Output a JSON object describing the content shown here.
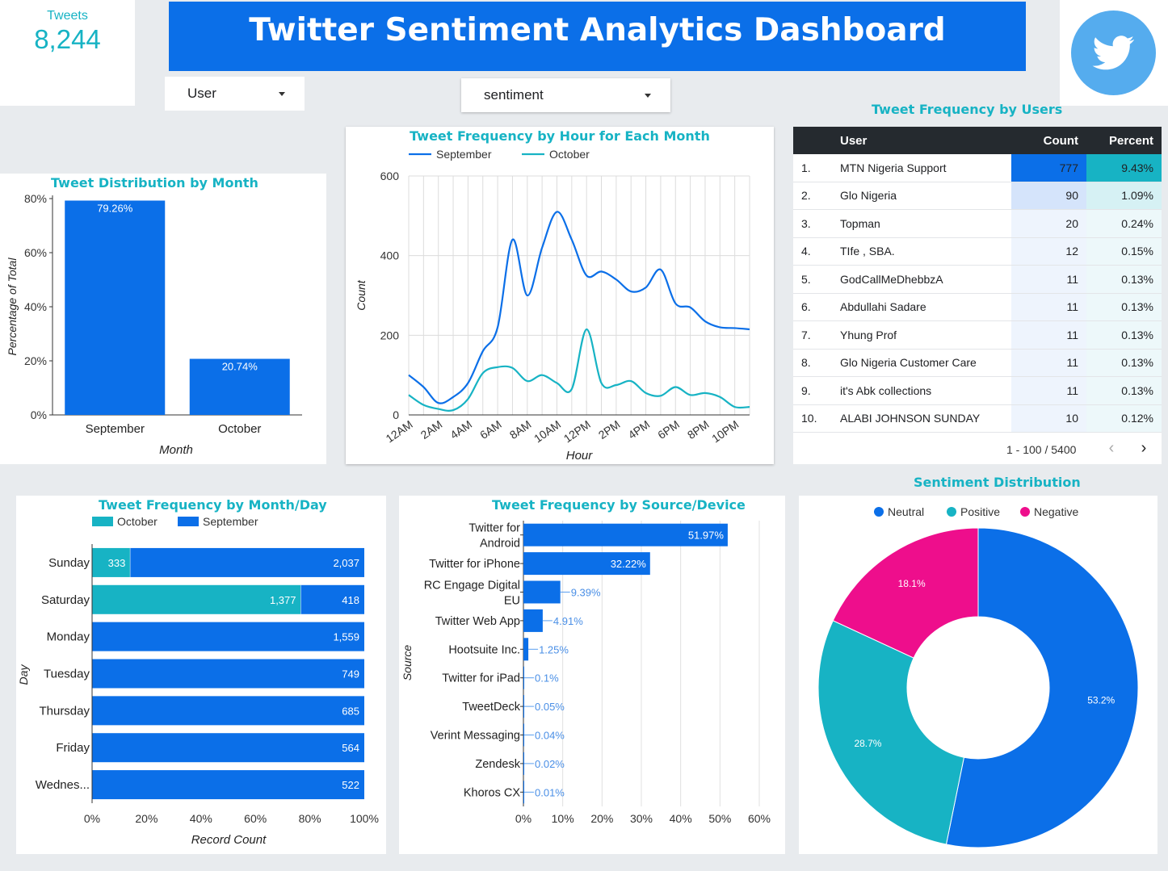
{
  "title": "Twitter Sentiment Analytics Dashboard",
  "kpi": {
    "label": "Tweets",
    "value": "8,244"
  },
  "filters": {
    "user_label": "User",
    "sentiment_label": "sentiment"
  },
  "colors": {
    "blue": "#0b6fe8",
    "teal": "#17b3c4",
    "pink": "#ee0e8c",
    "twitter": "#55acee",
    "header": "#0b6fe8"
  },
  "icons": {
    "twitter_logo": "twitter-bird-icon"
  },
  "month_dist": {
    "title": "Tweet Distribution by Month",
    "chart_data": {
      "type": "bar",
      "categories": [
        "September",
        "October"
      ],
      "values": [
        79.26,
        20.74
      ],
      "data_labels": [
        "79.26%",
        "20.74%"
      ],
      "xlabel": "Month",
      "ylabel": "Percentage of Total",
      "ylim": [
        0,
        80
      ],
      "yticks": [
        "0%",
        "20%",
        "40%",
        "60%",
        "80%"
      ]
    }
  },
  "hourly": {
    "title": "Tweet Frequency by Hour for Each Month",
    "chart_data": {
      "type": "line",
      "xlabel": "Hour",
      "ylabel": "Count",
      "ylim": [
        0,
        600
      ],
      "yticks": [
        "0",
        "200",
        "400",
        "600"
      ],
      "xticks": [
        "12AM",
        "2AM",
        "4AM",
        "6AM",
        "8AM",
        "10AM",
        "12PM",
        "2PM",
        "4PM",
        "6PM",
        "8PM",
        "10PM"
      ],
      "x": [
        0,
        1,
        2,
        3,
        4,
        5,
        6,
        7,
        8,
        9,
        10,
        11,
        12,
        13,
        14,
        15,
        16,
        17,
        18,
        19,
        20,
        21,
        22,
        23
      ],
      "series": [
        {
          "name": "September",
          "values": [
            100,
            70,
            30,
            45,
            80,
            160,
            220,
            440,
            300,
            420,
            510,
            440,
            350,
            360,
            340,
            310,
            320,
            365,
            280,
            270,
            235,
            220,
            218,
            215
          ]
        },
        {
          "name": "October",
          "values": [
            50,
            25,
            15,
            12,
            40,
            105,
            120,
            118,
            85,
            100,
            80,
            65,
            215,
            80,
            75,
            85,
            55,
            48,
            70,
            50,
            55,
            45,
            20,
            20
          ]
        }
      ],
      "legend": "top",
      "grid": true
    }
  },
  "users_table": {
    "title": "Tweet Frequency by Users",
    "headers": [
      "User",
      "Count",
      "Percent"
    ],
    "rows": [
      {
        "rank": "1.",
        "user": "MTN Nigeria Support",
        "count": "777",
        "percent": "9.43%"
      },
      {
        "rank": "2.",
        "user": "Glo Nigeria",
        "count": "90",
        "percent": "1.09%"
      },
      {
        "rank": "3.",
        "user": "Topman",
        "count": "20",
        "percent": "0.24%"
      },
      {
        "rank": "4.",
        "user": "TIfe , SBA.",
        "count": "12",
        "percent": "0.15%"
      },
      {
        "rank": "5.",
        "user": "GodCallMeDhebbzA",
        "count": "11",
        "percent": "0.13%"
      },
      {
        "rank": "6.",
        "user": "Abdullahi Sadare",
        "count": "11",
        "percent": "0.13%"
      },
      {
        "rank": "7.",
        "user": "Yhung Prof",
        "count": "11",
        "percent": "0.13%"
      },
      {
        "rank": "8.",
        "user": "Glo Nigeria Customer Care",
        "count": "11",
        "percent": "0.13%"
      },
      {
        "rank": "9.",
        "user": "it's Abk collections",
        "count": "11",
        "percent": "0.13%"
      },
      {
        "rank": "10.",
        "user": "ALABI JOHNSON SUNDAY",
        "count": "10",
        "percent": "0.12%"
      }
    ],
    "pagination": "1 - 100 / 5400"
  },
  "month_day": {
    "title": "Tweet Frequency by Month/Day",
    "chart_data": {
      "type": "bar",
      "orientation": "horizontal",
      "stacked": "percent",
      "categories": [
        "Sunday",
        "Saturday",
        "Monday",
        "Tuesday",
        "Thursday",
        "Friday",
        "Wednes..."
      ],
      "series": [
        {
          "name": "October",
          "values": [
            333,
            1377,
            0,
            0,
            0,
            0,
            0
          ],
          "labels": [
            "333",
            "1,377",
            "",
            "",
            "",
            "",
            ""
          ]
        },
        {
          "name": "September",
          "values": [
            2037,
            418,
            1559,
            749,
            685,
            564,
            522
          ],
          "labels": [
            "2,037",
            "418",
            "1,559",
            "749",
            "685",
            "564",
            "522"
          ]
        }
      ],
      "xlabel": "Record Count",
      "ylabel": "Day",
      "xticks": [
        "0%",
        "20%",
        "40%",
        "60%",
        "80%",
        "100%"
      ],
      "legend": "top"
    }
  },
  "source": {
    "title": "Tweet Frequency by Source/Device",
    "chart_data": {
      "type": "bar",
      "orientation": "horizontal",
      "categories": [
        [
          "Twitter for",
          "Android"
        ],
        [
          "Twitter for iPhone"
        ],
        [
          "RC Engage Digital",
          "EU"
        ],
        [
          "Twitter Web App"
        ],
        [
          "Hootsuite Inc."
        ],
        [
          "Twitter for iPad"
        ],
        [
          "TweetDeck"
        ],
        [
          "Verint Messaging"
        ],
        [
          "Zendesk"
        ],
        [
          "Khoros CX"
        ]
      ],
      "values": [
        51.97,
        32.22,
        9.39,
        4.91,
        1.25,
        0.1,
        0.05,
        0.04,
        0.02,
        0.01
      ],
      "data_labels": [
        "51.97%",
        "32.22%",
        "9.39%",
        "4.91%",
        "1.25%",
        "0.1%",
        "0.05%",
        "0.04%",
        "0.02%",
        "0.01%"
      ],
      "ylabel": "Source",
      "xlim": [
        0,
        60
      ],
      "xticks": [
        "0%",
        "10%",
        "20%",
        "30%",
        "40%",
        "50%",
        "60%"
      ]
    }
  },
  "sentiment": {
    "title": "Sentiment Distribution",
    "chart_data": {
      "type": "pie",
      "donut": true,
      "labels": [
        "Neutral",
        "Positive",
        "Negative"
      ],
      "values": [
        53.2,
        28.7,
        18.1
      ],
      "data_labels": [
        "53.2%",
        "28.7%",
        "18.1%"
      ],
      "colors": [
        "#0b6fe8",
        "#17b3c4",
        "#ee0e8c"
      ],
      "legend": "top"
    }
  }
}
